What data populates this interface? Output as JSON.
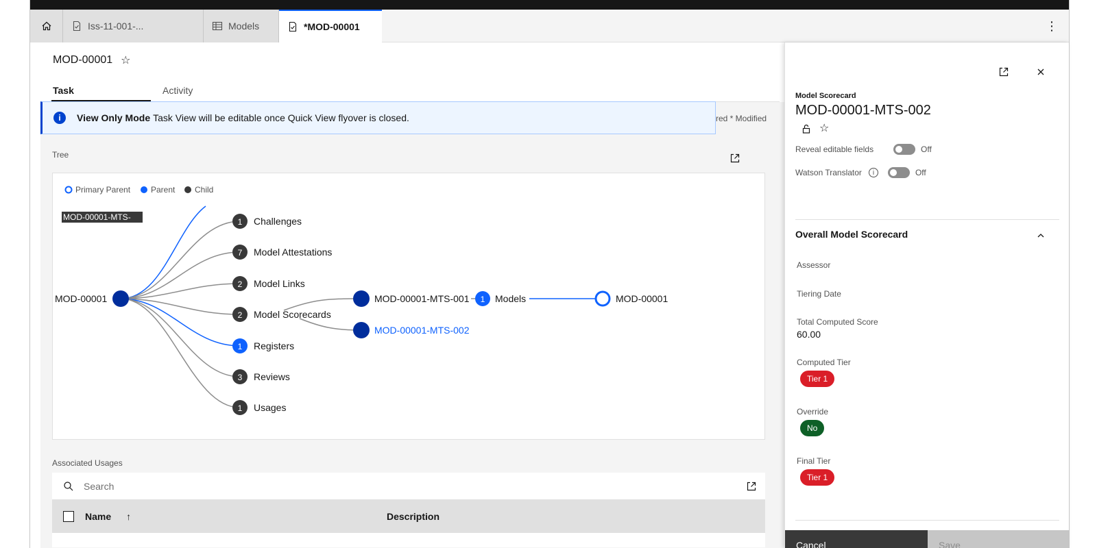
{
  "tabs": [
    {
      "label": "",
      "icon": "home-icon"
    },
    {
      "label": "Iss-11-001-...",
      "icon": "document-check-icon"
    },
    {
      "label": "Models",
      "icon": "table-icon"
    },
    {
      "label": "*MOD-00001",
      "icon": "document-check-icon",
      "active": true
    }
  ],
  "page": {
    "title": "MOD-00001",
    "content_tabs": [
      "Task",
      "Activity"
    ]
  },
  "banner": {
    "bold": "View Only Mode",
    "text": "Task View will be editable once Quick View flyover is closed."
  },
  "modified_text": "red  * Modified",
  "tree": {
    "section_label": "Tree",
    "legend": [
      "Primary Parent",
      "Parent",
      "Child"
    ],
    "tooltip": "MOD-00001-MTS-",
    "root": "MOD-00001",
    "children": [
      {
        "count": "1",
        "label": "Challenges"
      },
      {
        "count": "7",
        "label": "Model Attestations"
      },
      {
        "count": "2",
        "label": "Model Links"
      },
      {
        "count": "2",
        "label": "Model Scorecards"
      },
      {
        "count": "1",
        "label": "Registers"
      },
      {
        "count": "3",
        "label": "Reviews"
      },
      {
        "count": "1",
        "label": "Usages"
      }
    ],
    "scorecards": [
      "MOD-00001-MTS-001",
      "MOD-00001-MTS-002"
    ],
    "models_count": "1",
    "models_label": "Models",
    "target": "MOD-00001"
  },
  "usages": {
    "section_label": "Associated Usages",
    "search_placeholder": "Search",
    "columns": [
      "Name",
      "Description"
    ]
  },
  "flyover": {
    "label": "Model Scorecard",
    "title": "MOD-00001-MTS-002",
    "reveal_label": "Reveal editable fields",
    "reveal_state": "Off",
    "watson_label": "Watson Translator",
    "watson_state": "Off",
    "section_title": "Overall Model Scorecard",
    "fields": {
      "assessor": "Assessor",
      "tiering_date": "Tiering Date",
      "total_score_label": "Total Computed Score",
      "total_score_value": "60.00",
      "computed_tier_label": "Computed Tier",
      "computed_tier_value": "Tier 1",
      "override_label": "Override",
      "override_value": "No",
      "final_tier_label": "Final Tier",
      "final_tier_value": "Tier 1"
    },
    "cancel": "Cancel",
    "save": "Save"
  },
  "colors": {
    "primary_blue": "#0f62fe",
    "dark_blue": "#002d9c",
    "node_dark": "#393939",
    "tier_red": "#da1e28",
    "override_green": "#0e6027"
  }
}
